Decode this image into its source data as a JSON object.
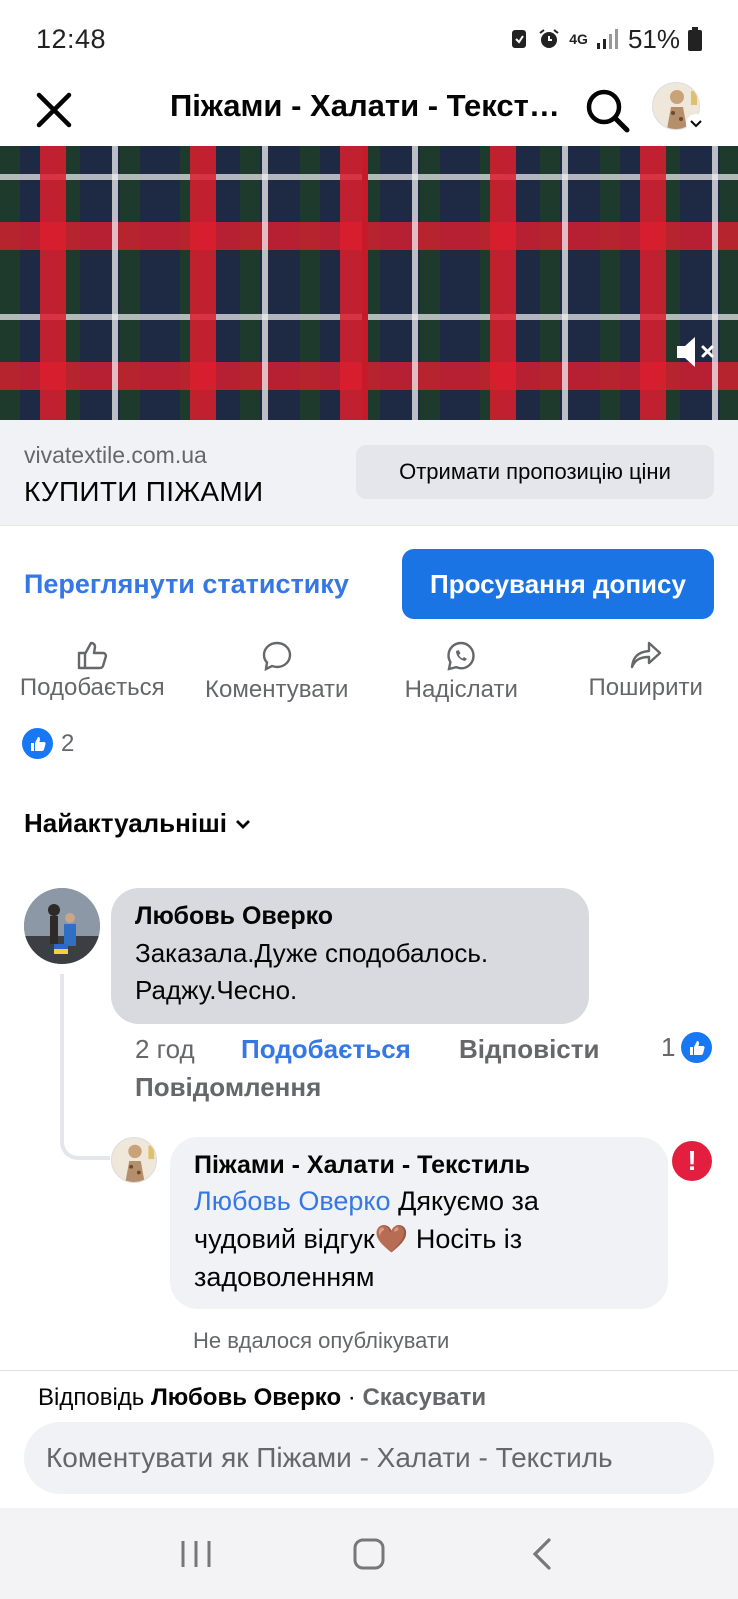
{
  "status_bar": {
    "time": "12:48",
    "network": "4G",
    "battery": "51%"
  },
  "header": {
    "title": "Піжами - Халати - Текстиль"
  },
  "cta": {
    "domain": "vivatextile.com.ua",
    "headline": "КУПИТИ ПІЖАМИ",
    "button_label": "Отримати пропозицію ціни"
  },
  "stats": {
    "view_insights": "Переглянути статистику",
    "boost_post": "Просування допису"
  },
  "actions": [
    {
      "label": "Подобається",
      "icon": "thumbs-up-icon"
    },
    {
      "label": "Коментувати",
      "icon": "comment-icon"
    },
    {
      "label": "Надіслати",
      "icon": "whatsapp-icon"
    },
    {
      "label": "Поширити",
      "icon": "share-icon"
    }
  ],
  "reactions": {
    "count": "2"
  },
  "sort": {
    "label": "Найактуальніші"
  },
  "comments": [
    {
      "author": "Любовь Оверко",
      "text": "Заказала.Дуже  сподобалось. Раджу.Чесно.",
      "time": "2 год",
      "like_label": "Подобається",
      "reply_label": "Відповісти",
      "message_label": "Повідомлення",
      "like_count": "1"
    }
  ],
  "reply": {
    "author": "Піжами - Халати - Текстиль",
    "mention": "Любовь Оверко",
    "text": " Дякуємо за чудовий відгук🤎 Носіть із задоволенням",
    "error_text": "Не вдалося опублікувати"
  },
  "composer": {
    "reply_prefix": "Відповідь",
    "reply_to": "Любовь Оверко",
    "separator": " · ",
    "cancel_label": "Скасувати",
    "placeholder": "Коментувати як Піжами - Халати - Текстиль"
  },
  "colors": {
    "link_blue": "#3578e5",
    "boost_blue": "#1b74e4",
    "error_red": "#e41e3f"
  }
}
